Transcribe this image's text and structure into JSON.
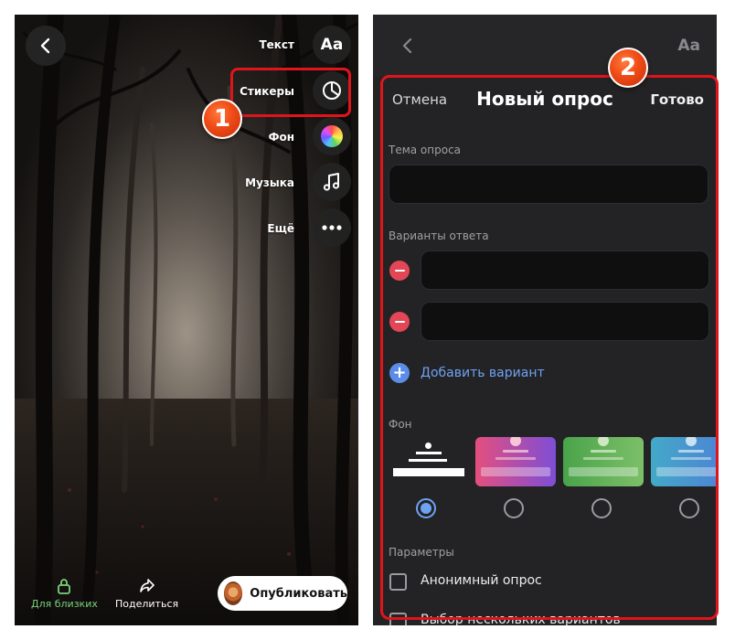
{
  "left_panel": {
    "tools": [
      {
        "label": "Текст",
        "icon": "text-format-icon",
        "icon_text": "Aa"
      },
      {
        "label": "Стикеры",
        "icon": "sticker-icon"
      },
      {
        "label": "Фон",
        "icon": "color-wheel-icon"
      },
      {
        "label": "Музыка",
        "icon": "music-note-icon"
      },
      {
        "label": "Ещё",
        "icon": "more-dots-icon"
      }
    ],
    "bottom": {
      "close_friends_label": "Для близких",
      "close_friends_color": "#7bd07b",
      "share_label": "Поделиться",
      "publish_label": "Опубликовать"
    }
  },
  "badges": [
    "1",
    "2"
  ],
  "right_panel": {
    "top_icon_text": "Aa",
    "header": {
      "cancel": "Отмена",
      "title": "Новый опрос",
      "done": "Готово"
    },
    "topic": {
      "label": "Тема опроса",
      "value": ""
    },
    "answers": {
      "label": "Варианты ответа",
      "options": [
        "",
        ""
      ]
    },
    "add_option_label": "Добавить вариант",
    "background": {
      "label": "Фон",
      "selected_index": 0,
      "options": [
        {
          "name": "plain",
          "colors": [
            "#ffffff"
          ]
        },
        {
          "name": "pink-purple",
          "colors": [
            "#e44f7e",
            "#7e4ed6"
          ]
        },
        {
          "name": "green",
          "colors": [
            "#4aa34a",
            "#7cc069"
          ]
        },
        {
          "name": "blue-teal",
          "colors": [
            "#43a9c8",
            "#4f7fd6"
          ]
        }
      ]
    },
    "params": {
      "label": "Параметры",
      "items": [
        {
          "label": "Анонимный опрос",
          "checked": false
        },
        {
          "label": "Выбор нескольких вариантов",
          "checked": false
        }
      ]
    }
  }
}
